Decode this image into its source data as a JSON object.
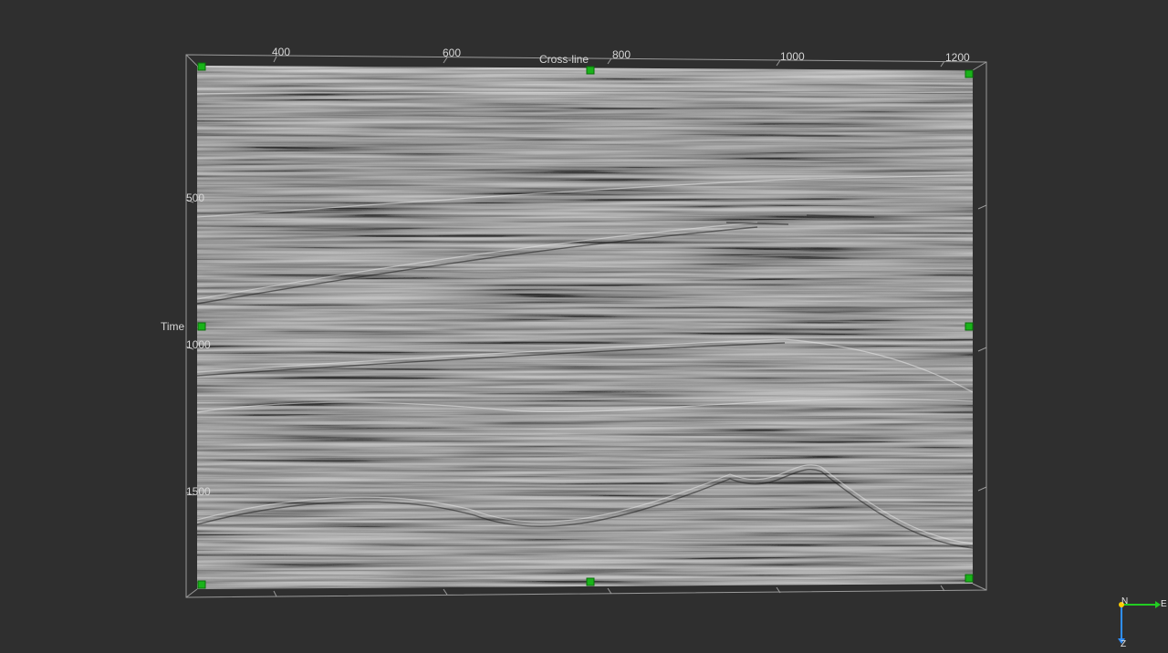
{
  "axes": {
    "top_title": "Cross-line",
    "left_title": "Time",
    "top_ticks": [
      "400",
      "600",
      "800",
      "1000",
      "1200"
    ],
    "left_ticks": [
      "500",
      "1000",
      "1500"
    ]
  },
  "compass": {
    "north": "N",
    "east": "E",
    "down": "Z",
    "colors": {
      "east_axis": "#22cc22",
      "down_axis": "#2f8fff",
      "origin": "#ffcc00"
    }
  },
  "handles_color": "#19b319"
}
